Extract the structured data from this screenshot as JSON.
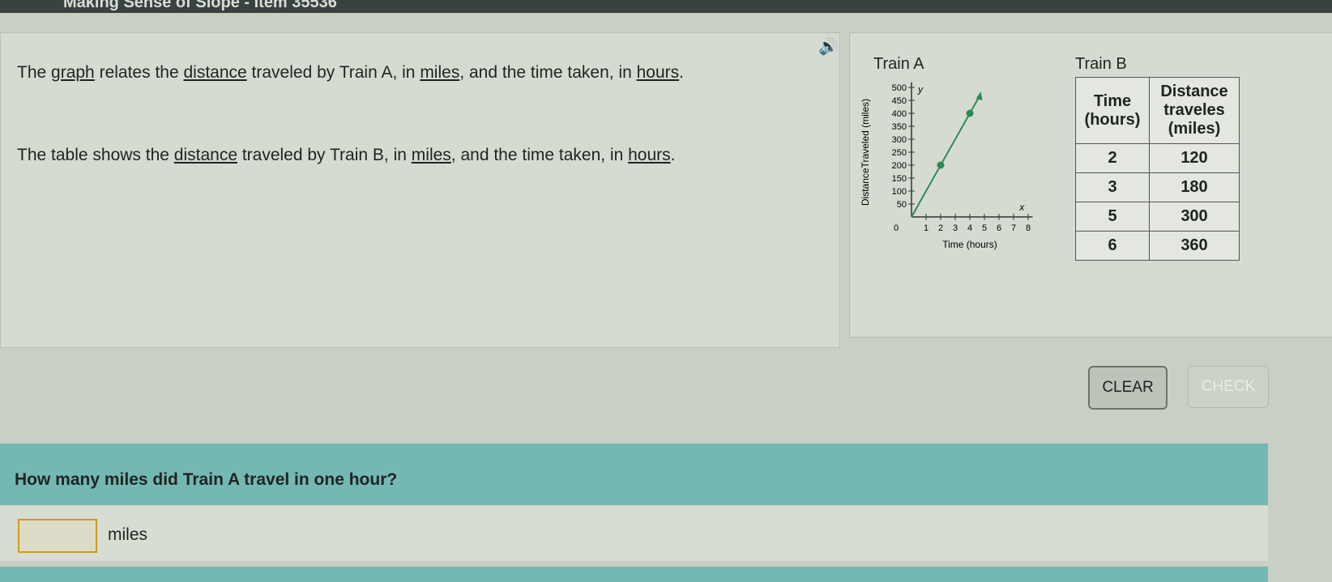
{
  "window": {
    "title": "Making Sense of Slope - Item 35536"
  },
  "prompt": {
    "p1": [
      "The ",
      "graph",
      " relates the ",
      "distance",
      " traveled by Train A, in ",
      "miles",
      ", and the time taken, in ",
      "hours",
      "."
    ],
    "p2": [
      "The table shows the ",
      "distance",
      " traveled by Train B, in ",
      "miles",
      ", and the time taken, in ",
      "hours",
      "."
    ]
  },
  "icons": {
    "audio": "speaker-icon"
  },
  "graph": {
    "title": "Train A",
    "ylabel": "DistanceTraveled (miles)",
    "xlabel": "Time (hours)",
    "x_axis_var": "x",
    "y_axis_var": "y",
    "origin": "0"
  },
  "chart_data": {
    "type": "line",
    "title": "Train A",
    "xlabel": "Time (hours)",
    "ylabel": "DistanceTraveled (miles)",
    "xlim": [
      0,
      8
    ],
    "ylim": [
      0,
      500
    ],
    "xticks": [
      "1",
      "2",
      "3",
      "4",
      "5",
      "6",
      "7",
      "8"
    ],
    "yticks": [
      "50",
      "100",
      "150",
      "200",
      "250",
      "300",
      "350",
      "400",
      "450",
      "500"
    ],
    "points": [
      {
        "x": 2,
        "y": 200
      },
      {
        "x": 4,
        "y": 400
      }
    ],
    "line": {
      "slope": 100,
      "intercept": 0,
      "arrow": true
    },
    "color": "#2e8a52"
  },
  "table": {
    "title": "Train B",
    "headers": [
      "Time (hours)",
      "Distance traveles (miles)"
    ],
    "rows": [
      [
        "2",
        "120"
      ],
      [
        "3",
        "180"
      ],
      [
        "5",
        "300"
      ],
      [
        "6",
        "360"
      ]
    ]
  },
  "buttons": {
    "clear": "CLEAR",
    "check": "CHECK"
  },
  "question": {
    "text": "How many miles did Train A travel in one hour?",
    "answer_value": "",
    "unit": "miles"
  }
}
